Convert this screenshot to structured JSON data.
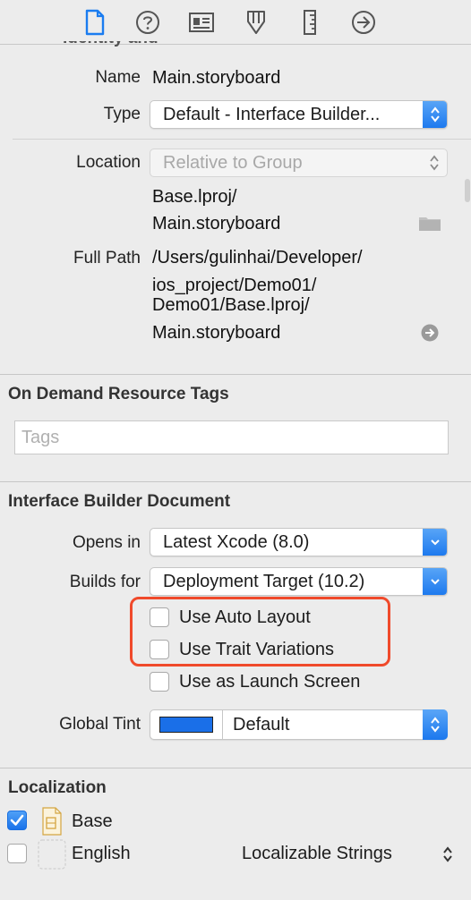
{
  "toolbar": {
    "icons": [
      "file-inspector-icon",
      "quick-help-icon",
      "identity-inspector-icon",
      "attributes-inspector-icon",
      "size-inspector-icon",
      "connections-inspector-icon"
    ],
    "active_color": "#1a7cf0"
  },
  "identity": {
    "name_label": "Name",
    "name_value": "Main.storyboard",
    "type_label": "Type",
    "type_value": "Default - Interface Builder...",
    "location_label": "Location",
    "location_value": "Relative to Group",
    "location_path_line1": "Base.lproj/",
    "location_path_line2": "Main.storyboard",
    "full_path_label": "Full Path",
    "full_path_lines": [
      "/Users/gulinhai/Developer/",
      "ios_project/Demo01/",
      "Demo01/Base.lproj/",
      "Main.storyboard"
    ]
  },
  "on_demand": {
    "title": "On Demand Resource Tags",
    "tags_placeholder": "Tags"
  },
  "ib_document": {
    "title": "Interface Builder Document",
    "opens_in_label": "Opens in",
    "opens_in_value": "Latest Xcode (8.0)",
    "builds_for_label": "Builds for",
    "builds_for_value": "Deployment Target (10.2)",
    "checkboxes": [
      {
        "label": "Use Auto Layout",
        "checked": false
      },
      {
        "label": "Use Trait Variations",
        "checked": false
      },
      {
        "label": "Use as Launch Screen",
        "checked": false
      }
    ],
    "global_tint_label": "Global Tint",
    "global_tint_value": "Default",
    "global_tint_color": "#1a6fe8",
    "highlight_color": "#f04a2b"
  },
  "localization": {
    "title": "Localization",
    "items": [
      {
        "label": "Base",
        "checked": true
      },
      {
        "label": "English",
        "checked": false,
        "option": "Localizable Strings"
      }
    ]
  }
}
